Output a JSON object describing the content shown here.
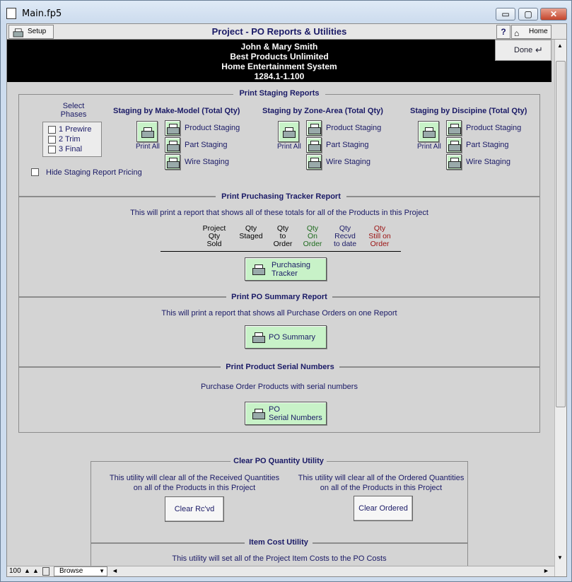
{
  "window": {
    "title": "Main.fp5",
    "minimize": "▭",
    "maximize": "▢",
    "close": "✕"
  },
  "header": {
    "setup_label": "Setup",
    "title": "Project - PO Reports & Utilities",
    "help_label": "?",
    "home_label": "Home",
    "done_label": "Done"
  },
  "client": {
    "line1": "John & Mary Smith",
    "line2": "Best Products Unlimited",
    "line3": "Home Entertainment System",
    "line4": "1284.1-1.100"
  },
  "staging": {
    "section_title": "Print Staging Reports",
    "phases_title_1": "Select",
    "phases_title_2": "Phases",
    "phases": [
      "1 Prewire",
      "2 Trim",
      "3 Final"
    ],
    "hide_pricing_label": "Hide Staging Report Pricing",
    "print_all_label": "Print All",
    "groups": [
      {
        "title": "Staging by Make-Model (Total Qty)",
        "items": [
          "Product Staging",
          "Part Staging",
          "Wire Staging"
        ]
      },
      {
        "title": "Staging by Zone-Area (Total Qty)",
        "items": [
          "Product Staging",
          "Part Staging",
          "Wire Staging"
        ]
      },
      {
        "title": "Staging by Discipine (Total Qty)",
        "items": [
          "Product Staging",
          "Part Staging",
          "Wire Staging"
        ]
      }
    ]
  },
  "tracker": {
    "section_title": "Print Pruchasing Tracker Report",
    "description": "This will print a report that shows all of these totals for all of the Products in this Project",
    "columns": [
      {
        "l1": "Project",
        "l2": "Qty",
        "l3": "Sold",
        "color": "#000000"
      },
      {
        "l1": "",
        "l2": "Qty",
        "l3": "Staged",
        "color": "#000000"
      },
      {
        "l1": "Qty",
        "l2": "to",
        "l3": "Order",
        "color": "#000000"
      },
      {
        "l1": "Qty",
        "l2": "On",
        "l3": "Order",
        "color": "#1d6b1d"
      },
      {
        "l1": "Qty",
        "l2": "Recvd",
        "l3": "to date",
        "color": "#1a1a66"
      },
      {
        "l1": "Qty",
        "l2": "Still on",
        "l3": "Order",
        "color": "#9a1010"
      }
    ],
    "button_l1": "Purchasing",
    "button_l2": "Tracker"
  },
  "po_summary": {
    "section_title": "Print PO Summary Report",
    "description": "This will print a report that shows all Purchase Orders on one Report",
    "button_label": "PO Summary"
  },
  "serial": {
    "section_title": "Print Product Serial Numbers",
    "description": "Purchase Order Products with serial numbers",
    "button_l1": "PO",
    "button_l2": "Serial Numbers"
  },
  "clear_po": {
    "section_title": "Clear PO Quantity Utility",
    "left_l1": "This utility will clear all of the Received Quantities",
    "left_l2": "on all of the Products in this Project",
    "right_l1": "This utility will clear all of the Ordered Quantities",
    "right_l2": "on all of the Products in this Project",
    "clear_rcvd_label": "Clear Rc'vd",
    "clear_ordered_label": "Clear Ordered"
  },
  "item_cost": {
    "section_title": "Item Cost Utility",
    "description": "This utility will set all of the Project Item Costs to the PO Costs"
  },
  "statusbar": {
    "zoom": "100",
    "mode": "Browse"
  }
}
